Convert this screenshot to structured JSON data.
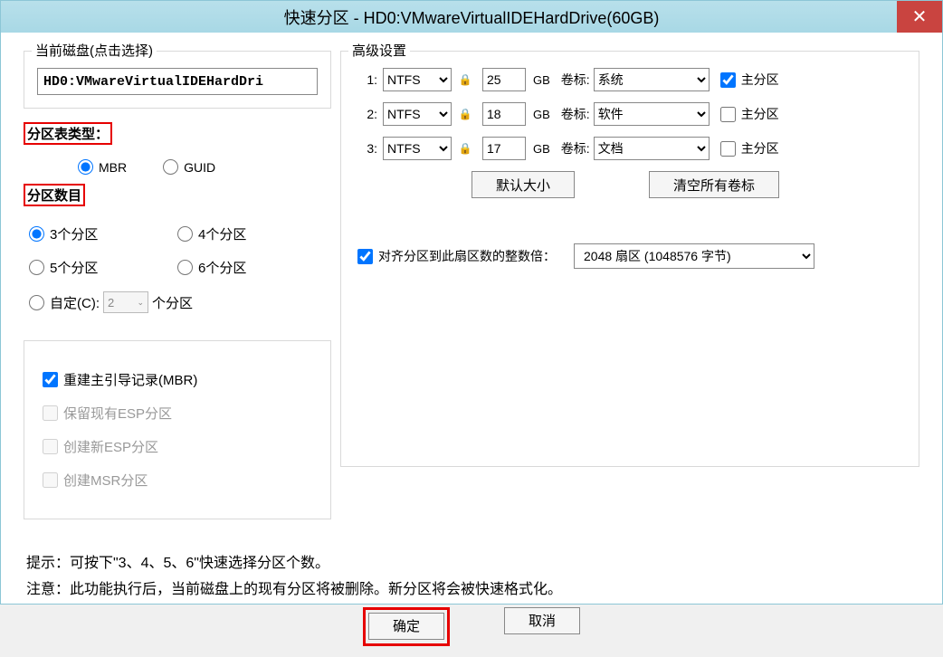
{
  "title": "快速分区 - HD0:VMwareVirtualIDEHardDrive(60GB)",
  "left": {
    "disk_group_title": "当前磁盘(点击选择)",
    "disk_value": "HD0:VMwareVirtualIDEHardDri",
    "table_type_label": "分区表类型：",
    "radio_mbr": "MBR",
    "radio_guid": "GUID",
    "part_count_label": "分区数目",
    "opt3": "3个分区",
    "opt4": "4个分区",
    "opt5": "5个分区",
    "opt6": "6个分区",
    "opt_custom": "自定(C):",
    "opt_custom_suffix": "个分区",
    "custom_value": "2",
    "cb_rebuild": "重建主引导记录(MBR)",
    "cb_keep_esp": "保留现有ESP分区",
    "cb_new_esp": "创建新ESP分区",
    "cb_msr": "创建MSR分区"
  },
  "right": {
    "adv_title": "高级设置",
    "rows": [
      {
        "num": "1:",
        "fs": "NTFS",
        "size": "25",
        "unit": "GB",
        "vol_label": "卷标:",
        "vol": "系统",
        "primary": true
      },
      {
        "num": "2:",
        "fs": "NTFS",
        "size": "18",
        "unit": "GB",
        "vol_label": "卷标:",
        "vol": "软件",
        "primary": false
      },
      {
        "num": "3:",
        "fs": "NTFS",
        "size": "17",
        "unit": "GB",
        "vol_label": "卷标:",
        "vol": "文档",
        "primary": false
      }
    ],
    "primary_label": "主分区",
    "btn_default": "默认大小",
    "btn_clear": "清空所有卷标",
    "align_label": "对齐分区到此扇区数的整数倍：",
    "align_value": "2048 扇区 (1048576 字节)"
  },
  "bottom": {
    "hint": "提示：可按下\"3、4、5、6\"快速选择分区个数。",
    "warn": "注意：此功能执行后，当前磁盘上的现有分区将被删除。新分区将会被快速格式化。",
    "ok": "确定",
    "cancel": "取消"
  }
}
